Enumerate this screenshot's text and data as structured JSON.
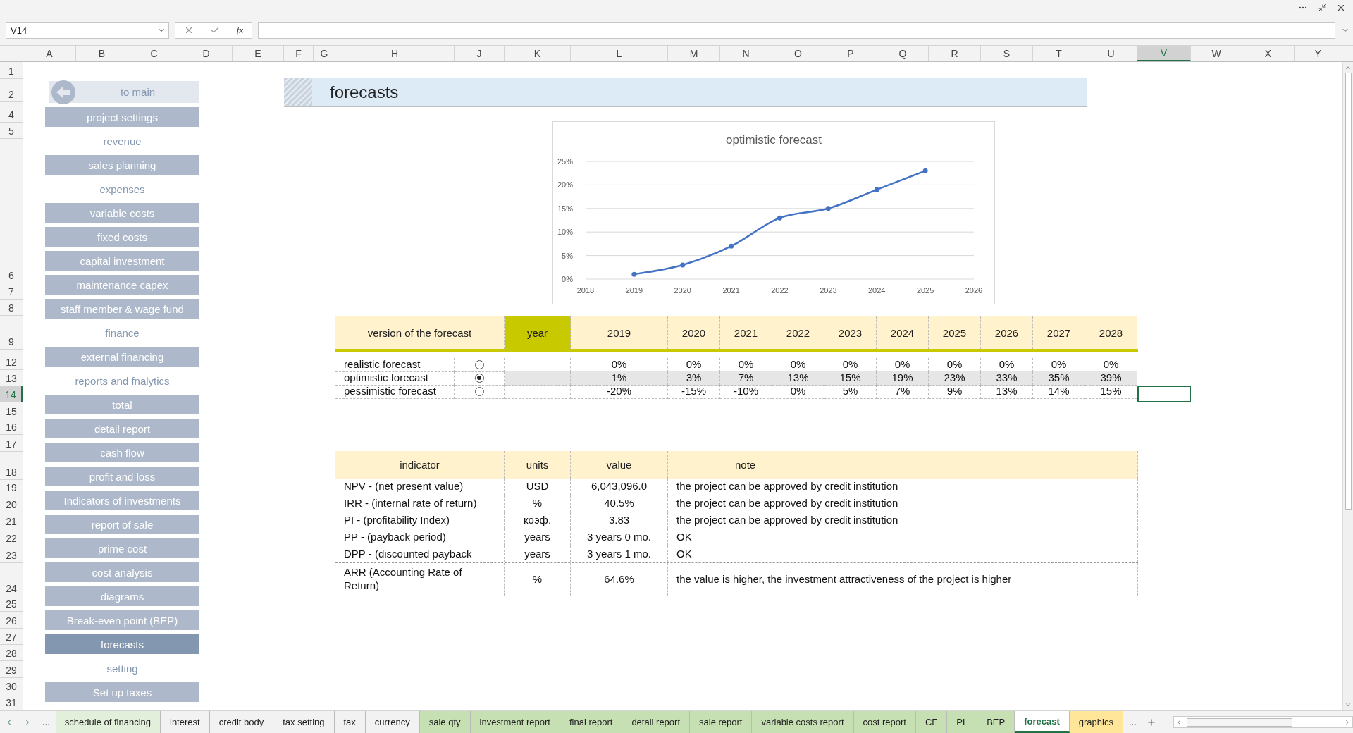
{
  "window": {
    "name_box": "V14",
    "function_label": "fx"
  },
  "column_headers": [
    {
      "label": "A",
      "selected": false
    },
    {
      "label": "B",
      "selected": false
    },
    {
      "label": "C",
      "selected": false
    },
    {
      "label": "D",
      "selected": false
    },
    {
      "label": "E",
      "selected": false
    },
    {
      "label": "F",
      "selected": false
    },
    {
      "label": "G",
      "selected": false
    },
    {
      "label": "H",
      "selected": false
    },
    {
      "label": "J",
      "selected": false
    },
    {
      "label": "K",
      "selected": false
    },
    {
      "label": "L",
      "selected": false
    },
    {
      "label": "M",
      "selected": false
    },
    {
      "label": "N",
      "selected": false
    },
    {
      "label": "O",
      "selected": false
    },
    {
      "label": "P",
      "selected": false
    },
    {
      "label": "Q",
      "selected": false
    },
    {
      "label": "R",
      "selected": false
    },
    {
      "label": "S",
      "selected": false
    },
    {
      "label": "T",
      "selected": false
    },
    {
      "label": "U",
      "selected": false
    },
    {
      "label": "V",
      "selected": true
    },
    {
      "label": "W",
      "selected": false
    },
    {
      "label": "X",
      "selected": false
    },
    {
      "label": "Y",
      "selected": false
    }
  ],
  "row_headers": [
    {
      "label": "1",
      "selected": false
    },
    {
      "label": "2",
      "selected": false
    },
    {
      "label": "4",
      "selected": false
    },
    {
      "label": "5",
      "selected": false
    },
    {
      "label": "6",
      "selected": false
    },
    {
      "label": "7",
      "selected": false
    },
    {
      "label": "8",
      "selected": false
    },
    {
      "label": "9",
      "selected": false
    },
    {
      "label": "12",
      "selected": false
    },
    {
      "label": "13",
      "selected": false
    },
    {
      "label": "14",
      "selected": true
    },
    {
      "label": "15",
      "selected": false
    },
    {
      "label": "16",
      "selected": false
    },
    {
      "label": "17",
      "selected": false
    },
    {
      "label": "18",
      "selected": false
    },
    {
      "label": "19",
      "selected": false
    },
    {
      "label": "20",
      "selected": false
    },
    {
      "label": "21",
      "selected": false
    },
    {
      "label": "22",
      "selected": false
    },
    {
      "label": "23",
      "selected": false
    },
    {
      "label": "24",
      "selected": false
    },
    {
      "label": "25",
      "selected": false
    },
    {
      "label": "26",
      "selected": false
    },
    {
      "label": "27",
      "selected": false
    },
    {
      "label": "28",
      "selected": false
    },
    {
      "label": "29",
      "selected": false
    },
    {
      "label": "30",
      "selected": false
    },
    {
      "label": "31",
      "selected": false
    }
  ],
  "sidebar": {
    "back_button": "to main",
    "items": [
      {
        "kind": "button",
        "label": "project settings",
        "selected": false
      },
      {
        "kind": "section",
        "label": "revenue"
      },
      {
        "kind": "button",
        "label": "sales planning",
        "selected": false
      },
      {
        "kind": "section",
        "label": "expenses"
      },
      {
        "kind": "button",
        "label": "variable costs",
        "selected": false
      },
      {
        "kind": "button",
        "label": "fixed costs",
        "selected": false
      },
      {
        "kind": "button",
        "label": "capital investment",
        "selected": false
      },
      {
        "kind": "button",
        "label": "maintenance capex",
        "selected": false
      },
      {
        "kind": "button",
        "label": "staff member & wage fund",
        "selected": false
      },
      {
        "kind": "section",
        "label": "finance"
      },
      {
        "kind": "button",
        "label": "external financing",
        "selected": false
      },
      {
        "kind": "section",
        "label": "reports and fnalytics"
      },
      {
        "kind": "button",
        "label": "total",
        "selected": false
      },
      {
        "kind": "button",
        "label": "detail report",
        "selected": false
      },
      {
        "kind": "button",
        "label": "cash flow",
        "selected": false
      },
      {
        "kind": "button",
        "label": "profit and loss",
        "selected": false
      },
      {
        "kind": "button",
        "label": "Indicators of investments",
        "selected": false
      },
      {
        "kind": "button",
        "label": "report of sale",
        "selected": false
      },
      {
        "kind": "button",
        "label": "prime cost",
        "selected": false
      },
      {
        "kind": "button",
        "label": "cost analysis",
        "selected": false
      },
      {
        "kind": "button",
        "label": "diagrams",
        "selected": false
      },
      {
        "kind": "button",
        "label": "Break-even point (BEP)",
        "selected": false
      },
      {
        "kind": "button",
        "label": "forecasts",
        "selected": true
      },
      {
        "kind": "section",
        "label": "setting"
      },
      {
        "kind": "button",
        "label": "Set up taxes",
        "selected": false
      }
    ]
  },
  "page_title": "forecasts",
  "chart": {
    "chart_data": {
      "type": "line",
      "title": "optimistic forecast",
      "x": [
        2019,
        2020,
        2021,
        2022,
        2023,
        2024,
        2025
      ],
      "series": [
        {
          "color": "#4472c4",
          "marker": true,
          "values": [
            0.01,
            0.03,
            0.07,
            0.13,
            0.15,
            0.19,
            0.23
          ]
        }
      ],
      "grid": true,
      "xlim": [
        2018,
        2026
      ],
      "ylim": [
        0,
        0.25
      ],
      "xticks": [
        2018,
        2019,
        2020,
        2021,
        2022,
        2023,
        2024,
        2025,
        2026
      ],
      "yticks": [
        {
          "value": 0,
          "label": "0%"
        },
        {
          "value": 0.05,
          "label": "5%"
        },
        {
          "value": 0.1,
          "label": "10%"
        },
        {
          "value": 0.15,
          "label": "15%"
        },
        {
          "value": 0.2,
          "label": "20%"
        },
        {
          "value": 0.25,
          "label": "25%"
        }
      ]
    }
  },
  "forecast_table": {
    "version_header": "version of the forecast",
    "year_header": "year",
    "years": [
      "2019",
      "2020",
      "2021",
      "2022",
      "2023",
      "2024",
      "2025",
      "2026",
      "2027",
      "2028"
    ],
    "rows": [
      {
        "label": "realistic forecast",
        "selected": false,
        "values": [
          "0%",
          "0%",
          "0%",
          "0%",
          "0%",
          "0%",
          "0%",
          "0%",
          "0%",
          "0%"
        ]
      },
      {
        "label": "optimistic forecast",
        "selected": true,
        "values": [
          "1%",
          "3%",
          "7%",
          "13%",
          "15%",
          "19%",
          "23%",
          "33%",
          "35%",
          "39%"
        ]
      },
      {
        "label": "pessimistic forecast",
        "selected": false,
        "values": [
          "-20%",
          "-15%",
          "-10%",
          "0%",
          "5%",
          "7%",
          "9%",
          "13%",
          "14%",
          "15%"
        ]
      }
    ]
  },
  "indicators_table": {
    "columns": [
      "indicator",
      "units",
      "value",
      "note"
    ],
    "rows": [
      [
        "NPV - (net present value)",
        "USD",
        "6,043,096.0",
        "the project can be approved by credit institution"
      ],
      [
        "IRR - (internal rate of return)",
        "%",
        "40.5%",
        "the project can be approved by credit institution"
      ],
      [
        "PI - (profitability Index)",
        "коэф.",
        "3.83",
        "the project can be approved by credit institution"
      ],
      [
        "PP -  (payback period)",
        "years",
        "3 years 0 mo.",
        "OK"
      ],
      [
        "DPP - (discounted payback",
        "years",
        "3 years 1 mo.",
        "OK"
      ],
      [
        "ARR  (Accounting Rate of Return)",
        "%",
        "64.6%",
        "the value is higher, the investment attractiveness of the project is higher"
      ]
    ]
  },
  "sheet_tabs": {
    "more_left": "...",
    "more_right": "...",
    "tabs": [
      {
        "label": "schedule of financing",
        "selected": false,
        "color": "#e2efda"
      },
      {
        "label": "interest",
        "selected": false,
        "color": "#f2f2f2"
      },
      {
        "label": "credit body",
        "selected": false,
        "color": "#f2f2f2"
      },
      {
        "label": "tax setting",
        "selected": false,
        "color": "#f2f2f2"
      },
      {
        "label": "tax",
        "selected": false,
        "color": "#f2f2f2"
      },
      {
        "label": "currency",
        "selected": false,
        "color": "#f2f2f2"
      },
      {
        "label": "sale qty",
        "selected": false,
        "color": "#c6e0b4"
      },
      {
        "label": "investment report",
        "selected": false,
        "color": "#c6e0b4"
      },
      {
        "label": "final report",
        "selected": false,
        "color": "#c6e0b4"
      },
      {
        "label": "detail report",
        "selected": false,
        "color": "#c6e0b4"
      },
      {
        "label": "sale report",
        "selected": false,
        "color": "#c6e0b4"
      },
      {
        "label": "variable costs report",
        "selected": false,
        "color": "#c6e0b4"
      },
      {
        "label": "cost report",
        "selected": false,
        "color": "#c6e0b4"
      },
      {
        "label": "CF",
        "selected": false,
        "color": "#c6e0b4"
      },
      {
        "label": "PL",
        "selected": false,
        "color": "#c6e0b4"
      },
      {
        "label": "BEP",
        "selected": false,
        "color": "#c6e0b4"
      },
      {
        "label": "forecast",
        "selected": true,
        "color": "#ffffff"
      },
      {
        "label": "graphics",
        "selected": false,
        "color": "#ffe699"
      }
    ]
  }
}
